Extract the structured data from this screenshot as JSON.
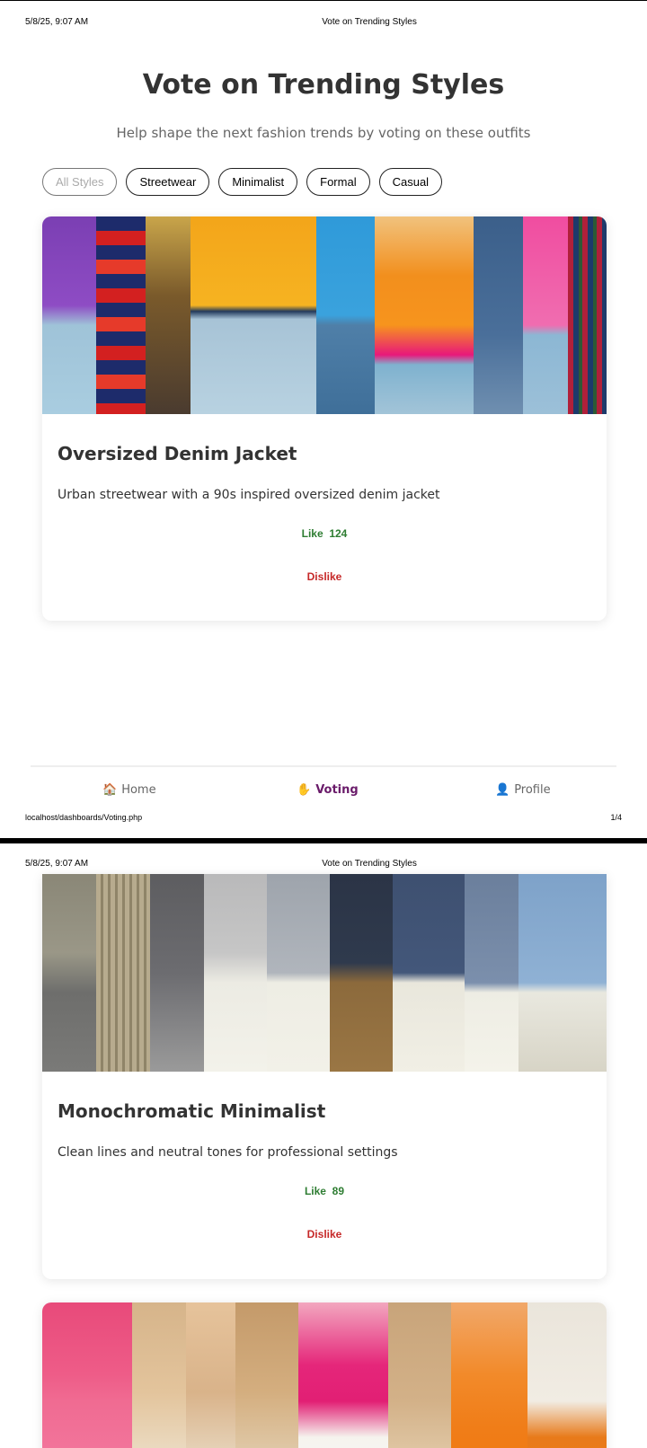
{
  "print": {
    "datetime": "5/8/25, 9:07 AM",
    "doc_title": "Vote on Trending Styles",
    "url": "localhost/dashboards/Voting.php",
    "page_indicator": "1/4"
  },
  "header": {
    "title": "Vote on Trending Styles",
    "subtitle": "Help shape the next fashion trends by voting on these outfits"
  },
  "filters": [
    {
      "label": "All Styles",
      "active": true
    },
    {
      "label": "Streetwear",
      "active": false
    },
    {
      "label": "Minimalist",
      "active": false
    },
    {
      "label": "Formal",
      "active": false
    },
    {
      "label": "Casual",
      "active": false
    }
  ],
  "cards": [
    {
      "title": "Oversized Denim Jacket",
      "description": "Urban streetwear with a 90s inspired oversized denim jacket",
      "like_label": "Like",
      "like_count": "124",
      "dislike_label": "Dislike"
    },
    {
      "title": "Monochromatic Minimalist",
      "description": "Clean lines and neutral tones for professional settings",
      "like_label": "Like",
      "like_count": "89",
      "dislike_label": "Dislike"
    }
  ],
  "nav": {
    "home": {
      "label": "Home",
      "icon": "house-icon"
    },
    "voting": {
      "label": "Voting",
      "icon": "hand-icon"
    },
    "profile": {
      "label": "Profile",
      "icon": "person-icon"
    }
  },
  "colors": {
    "like": "#2e7d32",
    "dislike": "#c62828",
    "nav_active": "#6a1b6a"
  }
}
